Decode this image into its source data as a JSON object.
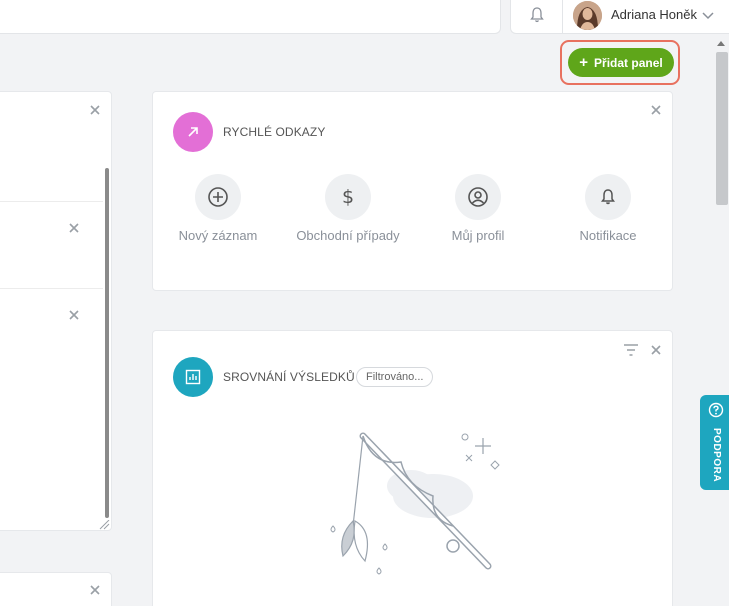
{
  "header": {
    "user_name": "Adriana Honěk",
    "icons": [
      "bell-icon",
      "avatar",
      "chevron-down-icon"
    ]
  },
  "toolbar": {
    "add_panel_label": "Přidat panel",
    "add_panel_color": "#5fa61a",
    "highlight_color": "#e8715f"
  },
  "quick_links": {
    "title": "RYCHLÉ ODKAZY",
    "icon": "arrow-up-right-icon",
    "icon_color": "#e36fd6",
    "items": [
      {
        "label": "Nový záznam",
        "icon": "plus-circle-icon"
      },
      {
        "label": "Obchodní případy",
        "icon": "dollar-icon"
      },
      {
        "label": "Můj profil",
        "icon": "user-circle-icon"
      },
      {
        "label": "Notifikace",
        "icon": "bell-icon"
      }
    ]
  },
  "results": {
    "title": "SROVNÁNÍ VÝSLEDKŮ",
    "icon": "chart-icon",
    "icon_color": "#1ea6bf",
    "filter_badge": "Filtrováno..."
  },
  "support": {
    "label": "PODPORA",
    "color": "#1ea6bf"
  }
}
